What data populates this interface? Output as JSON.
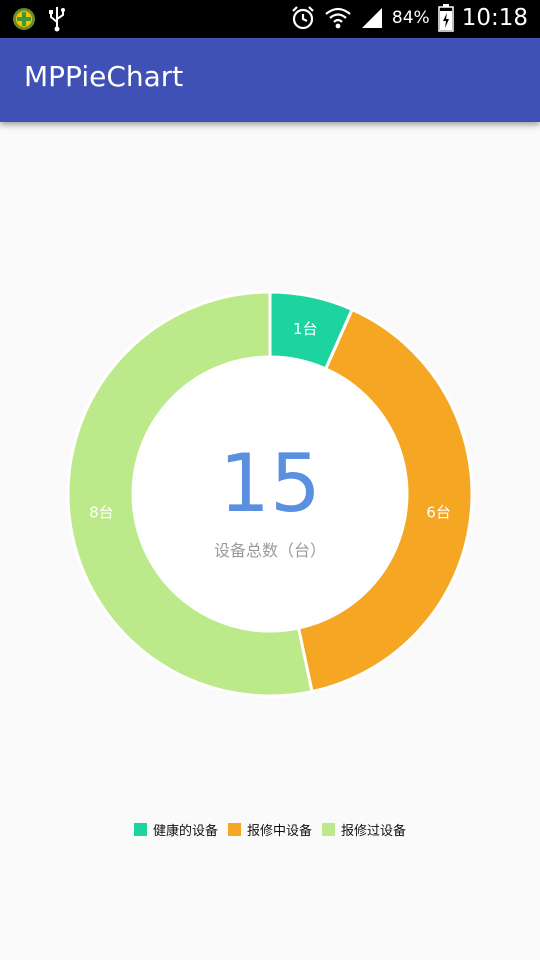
{
  "status_bar": {
    "battery": "84%",
    "time": "10:18",
    "icons": [
      "app-notification-icon",
      "usb-icon",
      "alarm-icon",
      "wifi-icon",
      "signal-icon",
      "battery-icon"
    ]
  },
  "app_bar": {
    "title": "MPPieChart",
    "color": "#3f51b5"
  },
  "chart_data": {
    "type": "pie",
    "style": "donut",
    "slices": [
      {
        "name": "健康的设备",
        "value": 1,
        "label": "1台",
        "color": "#1dd4a0"
      },
      {
        "name": "报修中设备",
        "value": 6,
        "label": "6台",
        "color": "#f5a623"
      },
      {
        "name": "报修过设备",
        "value": 8,
        "label": "8台",
        "color": "#bce98a"
      }
    ],
    "center_total": "15",
    "center_label": "设备总数（台）",
    "legend_position": "bottom-center"
  }
}
